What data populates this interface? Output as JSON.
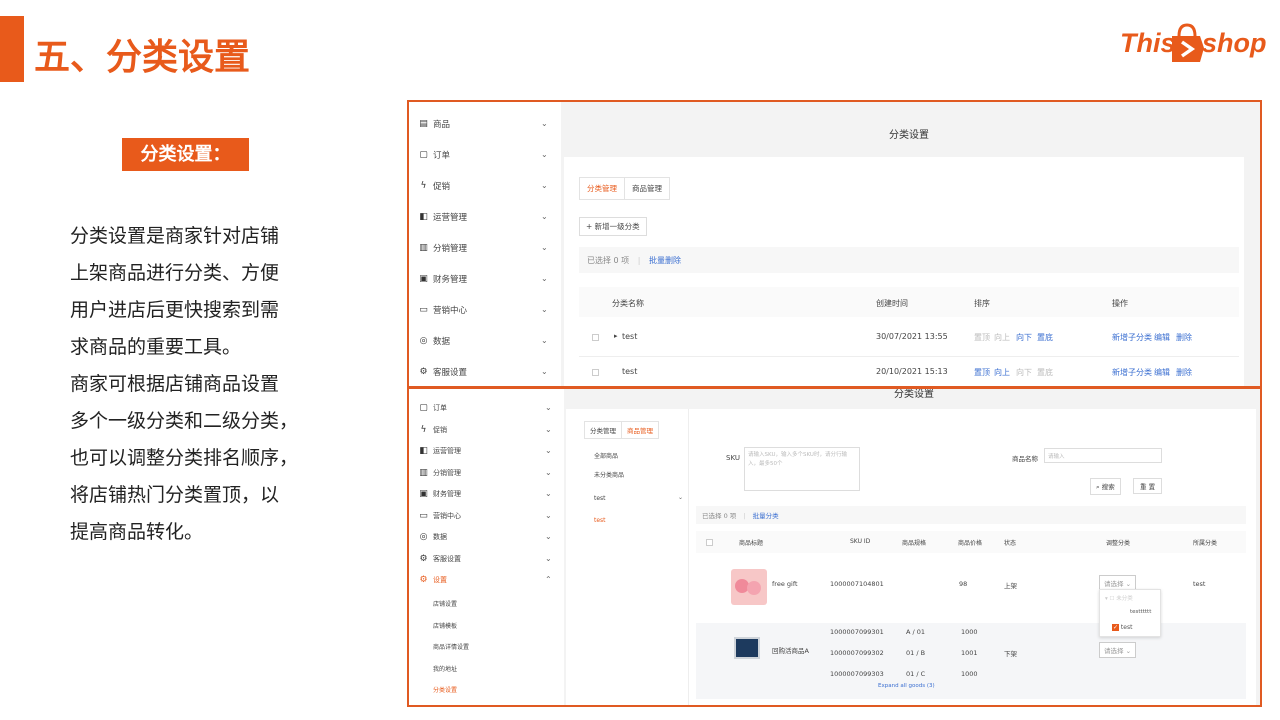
{
  "slide": {
    "title": "五、分类设置",
    "badge": "分类设置：",
    "description": [
      "分类设置是商家针对店铺",
      "上架商品进行分类、方便",
      "用户进店后更快搜索到需",
      "求商品的重要工具。",
      "商家可根据店铺商品设置",
      "多个一级分类和二级分类，",
      "也可以调整分类排名顺序，",
      "将店铺热门分类置顶，以",
      "提高商品转化。"
    ],
    "logo": {
      "left": "This",
      "right": "shop"
    },
    "accent_color": "#e85a1b"
  },
  "shot1": {
    "sidebar": [
      {
        "icon": "product-icon",
        "glyph": "▤",
        "label": "商品"
      },
      {
        "icon": "order-icon",
        "glyph": "▢",
        "label": "订单"
      },
      {
        "icon": "promo-icon",
        "glyph": "ϟ",
        "label": "促销"
      },
      {
        "icon": "ops-icon",
        "glyph": "◧",
        "label": "运营管理"
      },
      {
        "icon": "distribution-icon",
        "glyph": "▥",
        "label": "分销管理"
      },
      {
        "icon": "finance-icon",
        "glyph": "▣",
        "label": "财务管理"
      },
      {
        "icon": "marketing-icon",
        "glyph": "▭",
        "label": "营销中心"
      },
      {
        "icon": "data-icon",
        "glyph": "◎",
        "label": "数据"
      },
      {
        "icon": "settings-icon",
        "glyph": "⚙",
        "label": "客服设置"
      }
    ],
    "header_title": "分类设置",
    "tabs": [
      "分类管理",
      "商品管理"
    ],
    "add_button": "新增一级分类",
    "selection": {
      "text": "已选择 0 项",
      "sep": "|",
      "action": "批量删除"
    },
    "columns": [
      "分类名称",
      "创建时间",
      "排序",
      "操作"
    ],
    "rows": [
      {
        "name": "test",
        "time": "30/07/2021 13:55",
        "sort": [
          "置顶",
          "向上",
          "向下",
          "置底"
        ],
        "ops": [
          "新增子分类",
          "编辑",
          "删除"
        ]
      },
      {
        "name": "test",
        "time": "20/10/2021 15:13",
        "sort": [
          "置顶",
          "向上",
          "向下",
          "置底"
        ],
        "ops": [
          "新增子分类",
          "编辑",
          "删除"
        ]
      }
    ]
  },
  "shot2": {
    "header_title": "分类设置",
    "sidebar": [
      {
        "icon": "order-icon",
        "glyph": "▢",
        "label": "订单"
      },
      {
        "icon": "promo-icon",
        "glyph": "ϟ",
        "label": "促销"
      },
      {
        "icon": "ops-icon",
        "glyph": "◧",
        "label": "运营管理"
      },
      {
        "icon": "distribution-icon",
        "glyph": "▥",
        "label": "分销管理"
      },
      {
        "icon": "finance-icon",
        "glyph": "▣",
        "label": "财务管理"
      },
      {
        "icon": "marketing-icon",
        "glyph": "▭",
        "label": "营销中心"
      },
      {
        "icon": "data-icon",
        "glyph": "◎",
        "label": "数据"
      },
      {
        "icon": "service-icon",
        "glyph": "⚙",
        "label": "客服设置"
      },
      {
        "icon": "settings-icon",
        "glyph": "⚙",
        "label": "设置"
      }
    ],
    "sub_items": [
      "店铺设置",
      "店铺模板",
      "商品详情设置",
      "我的地址",
      "分类设置"
    ],
    "tabs": [
      "分类管理",
      "商品管理"
    ],
    "category_list": [
      "全部商品",
      "未分类商品",
      "test",
      "test"
    ],
    "sku_label": "SKU",
    "sku_placeholder": "请输入SKU，输入多个SKU时，请分行输入，最多50个",
    "name_label": "商品名称",
    "name_placeholder": "请输入",
    "search_button": "搜索",
    "reset_button": "重 置",
    "selection": {
      "text": "已选择 0 项",
      "sep": "|",
      "action": "批量分类"
    },
    "columns": [
      "商品标题",
      "SKU ID",
      "商品规格",
      "商品价格",
      "状态",
      "调整分类",
      "所属分类"
    ],
    "product1": {
      "title": "free gift",
      "sku": "1000007104801",
      "price": "98",
      "status": "上架",
      "select": "请选择",
      "category": "test"
    },
    "product2": {
      "title": "回购活商品A",
      "skus": [
        {
          "sku": "1000007099301",
          "spec": "A / 01",
          "price": "1000"
        },
        {
          "sku": "1000007099302",
          "spec": "01 / B",
          "price": "1001"
        },
        {
          "sku": "1000007099303",
          "spec": "01 / C",
          "price": "1000"
        }
      ],
      "status": "下架",
      "select": "请选择"
    },
    "expand": "Expand all goods (3)",
    "dropdown": [
      "未分类",
      "testttttt",
      "test"
    ]
  }
}
